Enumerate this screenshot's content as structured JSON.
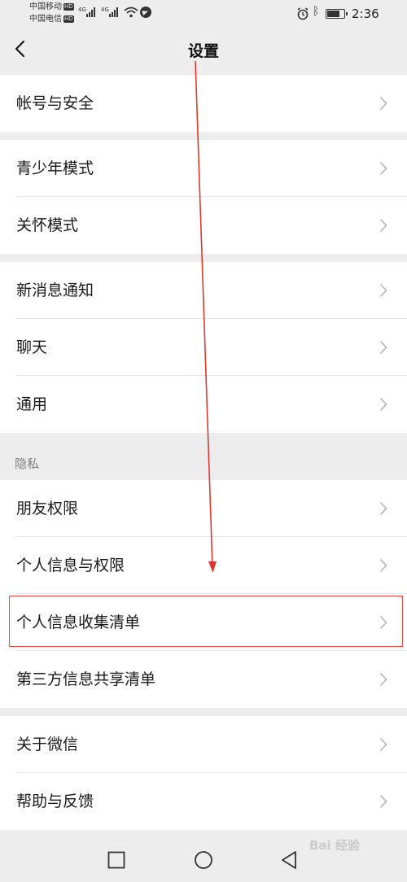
{
  "status_bar": {
    "carrier_1": "中国移动",
    "carrier_2": "中国电信",
    "hd_badge": "HD",
    "network_1": "4G",
    "network_2": "4G",
    "battery_level": 0.7,
    "time": "2:36"
  },
  "header": {
    "title": "设置",
    "back_icon": "chevron-left-icon"
  },
  "sections": [
    {
      "items": [
        {
          "label": "帐号与安全"
        }
      ]
    },
    {
      "items": [
        {
          "label": "青少年模式"
        },
        {
          "label": "关怀模式"
        }
      ]
    },
    {
      "items": [
        {
          "label": "新消息通知"
        },
        {
          "label": "聊天"
        },
        {
          "label": "通用"
        }
      ]
    },
    {
      "title": "隐私",
      "items": [
        {
          "label": "朋友权限"
        },
        {
          "label": "个人信息与权限"
        },
        {
          "label": "个人信息收集清单"
        },
        {
          "label": "第三方信息共享清单"
        }
      ]
    },
    {
      "items": [
        {
          "label": "关于微信"
        },
        {
          "label": "帮助与反馈"
        }
      ]
    }
  ],
  "annotation": {
    "color": "#e0443a",
    "highlighted_item": "个人信息收集清单"
  },
  "watermark": "Bai 经验",
  "colors": {
    "background": "#ededed",
    "row": "#ffffff",
    "chevron": "#b2b2b2",
    "section_label": "#7f7f7f"
  }
}
